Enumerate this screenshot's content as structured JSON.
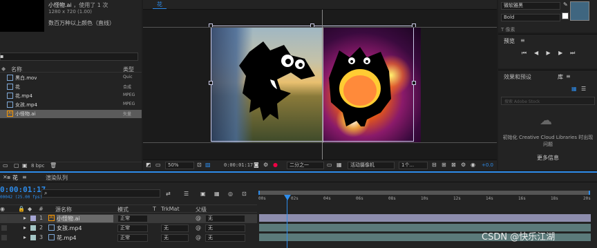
{
  "project": {
    "thumb_name": "小怪物.ai",
    "used_count": "，使用了 1 次",
    "resolution": "1280 x 720 (1.00)",
    "color_info": "数百万种以上颜色（直线）",
    "col_name": "名称",
    "col_type": "类型",
    "items": [
      {
        "name": "黑白.mov",
        "type": "Quic",
        "icon": "video-file-icon"
      },
      {
        "name": "花",
        "type": "合成",
        "icon": "composition-icon"
      },
      {
        "name": "花.mp4",
        "type": "MPEG",
        "icon": "video-file-icon"
      },
      {
        "name": "女孩.mp4",
        "type": "MPEG",
        "icon": "video-file-icon"
      },
      {
        "name": "小怪物.ai",
        "type": "矢量",
        "icon": "illustrator-file-icon"
      }
    ],
    "bpc": "8 bpc"
  },
  "viewer": {
    "tab": "花",
    "zoom": "50%",
    "timecode": "0:00:01:17",
    "resolution": "二分之一",
    "camera": "活动摄像机",
    "views": "1个...",
    "exposure": "+0.0"
  },
  "character": {
    "font": "微软雅黑",
    "style": "Bold",
    "size_label": "像素"
  },
  "preview": {
    "title": "预览",
    "menu": "≡"
  },
  "effects": {
    "tab1": "效果和预设",
    "tab2": "库",
    "search_placeholder": "搜索 Adobe Stock",
    "cc_message": "初始化 Creative Cloud Libraries 时出现问题",
    "more_info": "更多信息"
  },
  "timeline": {
    "tab": "花",
    "render_queue": "渲染队列",
    "timecode": "0:00:01:17",
    "frame_info": "00042 (25.00 fps)",
    "search_icon": "search-icon",
    "col_num": "#",
    "col_name": "源名称",
    "col_mode": "模式",
    "col_t": "T",
    "col_trkmat": "TrkMat",
    "col_parent": "父级",
    "layers": [
      {
        "num": "1",
        "name": "小怪物.ai",
        "mode": "正常",
        "trkmat": "",
        "parent": "无",
        "color": "#b7a37a",
        "label_color": "#a6a6d4"
      },
      {
        "num": "2",
        "name": "女孩.mp4",
        "mode": "正常",
        "trkmat": "无",
        "parent": "无",
        "color": "#a4c6c6",
        "label_color": "#a4c6c6"
      },
      {
        "num": "3",
        "name": "花.mp4",
        "mode": "正常",
        "trkmat": "无",
        "parent": "无",
        "color": "#a4c6c6",
        "label_color": "#a4c6c6"
      }
    ],
    "ruler": [
      "00s",
      "02s",
      "04s",
      "06s",
      "08s",
      "10s",
      "12s",
      "14s",
      "16s",
      "18s",
      "20s"
    ]
  },
  "watermark": "CSDN @快乐江湖"
}
